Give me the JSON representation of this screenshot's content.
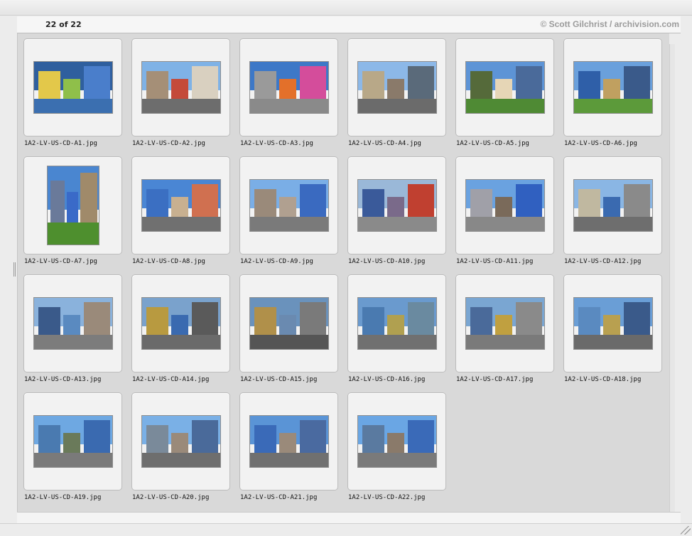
{
  "header": {
    "counter": "22 of 22",
    "credit": "© Scott Gilchrist / archivision.com"
  },
  "colors": {
    "grid_background": "#d9d9d9",
    "slide_background": "#f2f2f2",
    "credit_text": "#9b9b9b"
  },
  "thumbnails": [
    {
      "filename": "1A2-LV-US-CD-A1.jpg",
      "icon": "map-image"
    },
    {
      "filename": "1A2-LV-US-CD-A2.jpg",
      "icon": "street-image"
    },
    {
      "filename": "1A2-LV-US-CD-A3.jpg",
      "icon": "street-sign-image"
    },
    {
      "filename": "1A2-LV-US-CD-A4.jpg",
      "icon": "street-image"
    },
    {
      "filename": "1A2-LV-US-CD-A5.jpg",
      "icon": "palm-street-image"
    },
    {
      "filename": "1A2-LV-US-CD-A6.jpg",
      "icon": "palm-street-image"
    },
    {
      "filename": "1A2-LV-US-CD-A7.jpg",
      "icon": "portrait-building-image"
    },
    {
      "filename": "1A2-LV-US-CD-A8.jpg",
      "icon": "building-image"
    },
    {
      "filename": "1A2-LV-US-CD-A9.jpg",
      "icon": "building-image"
    },
    {
      "filename": "1A2-LV-US-CD-A10.jpg",
      "icon": "building-image"
    },
    {
      "filename": "1A2-LV-US-CD-A11.jpg",
      "icon": "building-image"
    },
    {
      "filename": "1A2-LV-US-CD-A12.jpg",
      "icon": "street-image"
    },
    {
      "filename": "1A2-LV-US-CD-A13.jpg",
      "icon": "building-image"
    },
    {
      "filename": "1A2-LV-US-CD-A14.jpg",
      "icon": "building-image"
    },
    {
      "filename": "1A2-LV-US-CD-A15.jpg",
      "icon": "building-image"
    },
    {
      "filename": "1A2-LV-US-CD-A16.jpg",
      "icon": "building-image"
    },
    {
      "filename": "1A2-LV-US-CD-A17.jpg",
      "icon": "building-image"
    },
    {
      "filename": "1A2-LV-US-CD-A18.jpg",
      "icon": "building-image"
    },
    {
      "filename": "1A2-LV-US-CD-A19.jpg",
      "icon": "building-image"
    },
    {
      "filename": "1A2-LV-US-CD-A20.jpg",
      "icon": "building-image"
    },
    {
      "filename": "1A2-LV-US-CD-A21.jpg",
      "icon": "building-image"
    },
    {
      "filename": "1A2-LV-US-CD-A22.jpg",
      "icon": "building-image"
    }
  ]
}
